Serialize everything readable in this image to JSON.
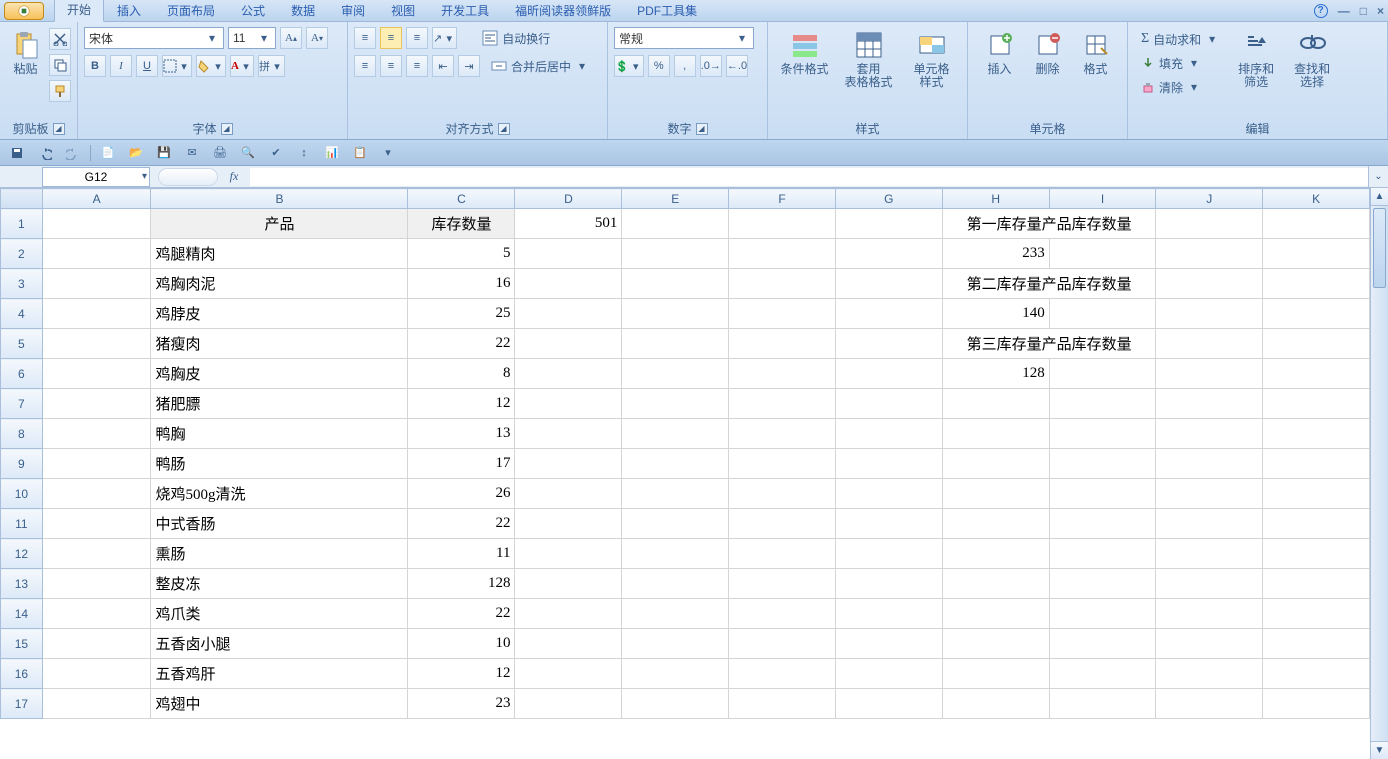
{
  "titlebar": {
    "tabs": [
      "开始",
      "插入",
      "页面布局",
      "公式",
      "数据",
      "审阅",
      "视图",
      "开发工具",
      "福昕阅读器领鲜版",
      "PDF工具集"
    ],
    "active_tab": 0,
    "help_icon": "?",
    "minimize": "—",
    "restore": "□",
    "close": "×"
  },
  "ribbon": {
    "clipboard": {
      "label": "剪贴板",
      "paste": "粘贴"
    },
    "font": {
      "label": "字体",
      "family": "宋体",
      "size": "11",
      "bold": "B",
      "italic": "I",
      "underline": "U"
    },
    "align": {
      "label": "对齐方式",
      "wrap": "自动换行",
      "merge": "合并后居中"
    },
    "number": {
      "label": "数字",
      "format": "常规"
    },
    "styles": {
      "label": "样式",
      "cond": "条件格式",
      "table": "套用\n表格格式",
      "cell": "单元格\n样式"
    },
    "cells": {
      "label": "单元格",
      "insert": "插入",
      "delete": "删除",
      "format": "格式"
    },
    "editing": {
      "label": "编辑",
      "autosum": "自动求和",
      "fill": "填充",
      "clear": "清除",
      "sort": "排序和\n筛选",
      "find": "查找和\n选择"
    }
  },
  "namebox": "G12",
  "formula": "",
  "columns": [
    "A",
    "B",
    "C",
    "D",
    "E",
    "F",
    "G",
    "H",
    "I",
    "J",
    "K"
  ],
  "rows": [
    {
      "n": 1,
      "B": "产品",
      "C": "库存数量",
      "D": "501",
      "Bhdr": true,
      "Chdr": true,
      "Dnum": true,
      "HI": "第一库存量产品库存数量"
    },
    {
      "n": 2,
      "B": "鸡腿精肉",
      "C": "5",
      "Cnum": true,
      "H": "233",
      "Hnum": true
    },
    {
      "n": 3,
      "B": "鸡胸肉泥",
      "C": "16",
      "Cnum": true,
      "HI": "第二库存量产品库存数量"
    },
    {
      "n": 4,
      "B": "鸡脖皮",
      "C": "25",
      "Cnum": true,
      "H": "140",
      "Hnum": true
    },
    {
      "n": 5,
      "B": "猪瘦肉",
      "C": "22",
      "Cnum": true,
      "HI": "第三库存量产品库存数量"
    },
    {
      "n": 6,
      "B": "鸡胸皮",
      "C": "8",
      "Cnum": true,
      "H": "128",
      "Hnum": true
    },
    {
      "n": 7,
      "B": "猪肥膘",
      "C": "12",
      "Cnum": true
    },
    {
      "n": 8,
      "B": "鸭胸",
      "C": "13",
      "Cnum": true
    },
    {
      "n": 9,
      "B": "鸭肠",
      "C": "17",
      "Cnum": true
    },
    {
      "n": 10,
      "B": "烧鸡500g清洗",
      "C": "26",
      "Cnum": true
    },
    {
      "n": 11,
      "B": "中式香肠",
      "C": "22",
      "Cnum": true
    },
    {
      "n": 12,
      "B": "熏肠",
      "C": "11",
      "Cnum": true
    },
    {
      "n": 13,
      "B": "整皮冻",
      "C": "128",
      "Cnum": true
    },
    {
      "n": 14,
      "B": "鸡爪类",
      "C": "22",
      "Cnum": true
    },
    {
      "n": 15,
      "B": "五香卤小腿",
      "C": "10",
      "Cnum": true
    },
    {
      "n": 16,
      "B": "五香鸡肝",
      "C": "12",
      "Cnum": true
    },
    {
      "n": 17,
      "B": "鸡翅中",
      "C": "23",
      "Cnum": true
    }
  ]
}
